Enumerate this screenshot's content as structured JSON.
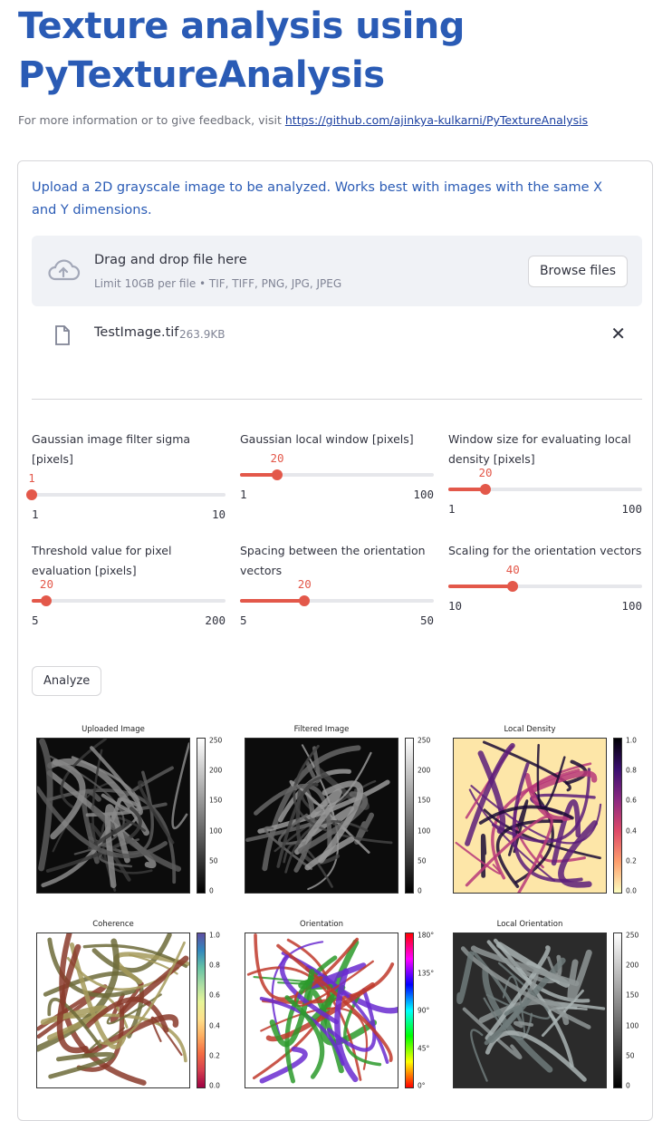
{
  "header": {
    "title": "Texture analysis using PyTextureAnalysis",
    "info_text": "For more information or to give feedback, visit ",
    "info_link": "https://github.com/ajinkya-kulkarni/PyTextureAnalysis"
  },
  "uploader": {
    "label": "Upload a 2D grayscale image to be analyzed. Works best with images with the same X and Y dimensions.",
    "drop_title": "Drag and drop file here",
    "drop_sub": "Limit 10GB per file • TIF, TIFF, PNG, JPG, JPEG",
    "browse_label": "Browse files",
    "file_name": "TestImage.tif",
    "file_size": "263.9KB",
    "close_symbol": "✕"
  },
  "sliders": [
    {
      "label": "Gaussian image filter sigma [pixels]",
      "value": "1",
      "min": "1",
      "max": "10"
    },
    {
      "label": "Gaussian local window [pixels]",
      "value": "20",
      "min": "1",
      "max": "100"
    },
    {
      "label": "Window size for evaluating local density [pixels]",
      "value": "20",
      "min": "1",
      "max": "100"
    },
    {
      "label": "Threshold value for pixel evaluation [pixels]",
      "value": "20",
      "min": "5",
      "max": "200"
    },
    {
      "label": "Spacing between the orientation vectors",
      "value": "20",
      "min": "5",
      "max": "50"
    },
    {
      "label": "Scaling for the orientation vectors",
      "value": "40",
      "min": "10",
      "max": "100"
    }
  ],
  "analyze_label": "Analyze",
  "plots": [
    {
      "title": "Uploaded Image",
      "ticks": [
        "250",
        "200",
        "150",
        "100",
        "50",
        "0"
      ],
      "colormap": "gray"
    },
    {
      "title": "Filtered Image",
      "ticks": [
        "250",
        "200",
        "150",
        "100",
        "50",
        "0"
      ],
      "colormap": "gray"
    },
    {
      "title": "Local Density",
      "ticks": [
        "1.0",
        "0.8",
        "0.6",
        "0.4",
        "0.2",
        "0.0"
      ],
      "colormap": "magma"
    },
    {
      "title": "Coherence",
      "ticks": [
        "1.0",
        "0.8",
        "0.6",
        "0.4",
        "0.2",
        "0.0"
      ],
      "colormap": "spectral"
    },
    {
      "title": "Orientation",
      "ticks": [
        "180°",
        "135°",
        "90°",
        "45°",
        "0°"
      ],
      "colormap": "hsv"
    },
    {
      "title": "Local Orientation",
      "ticks": [
        "250",
        "200",
        "150",
        "100",
        "50",
        "0"
      ],
      "colormap": "gray"
    }
  ],
  "colors": {
    "accent": "#e3584a",
    "title_blue": "#2a5bb5",
    "link_blue": "#1a3fa0"
  }
}
